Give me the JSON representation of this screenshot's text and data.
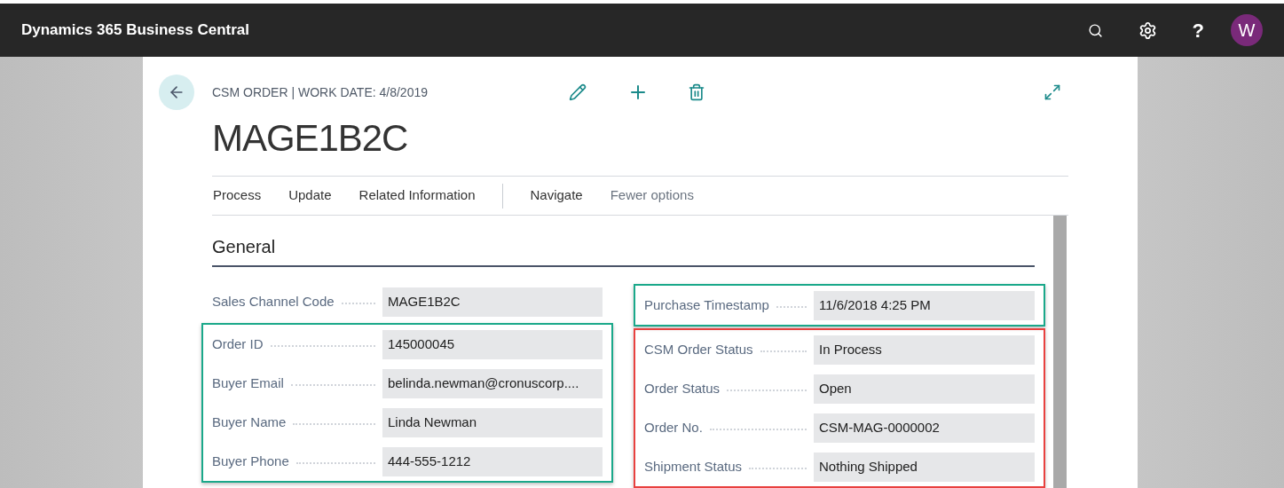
{
  "app_bar": {
    "title": "Dynamics 365 Business Central",
    "help": "?",
    "avatar": "W"
  },
  "page": {
    "caption": "CSM ORDER | WORK DATE: 4/8/2019",
    "title": "MAGE1B2C",
    "actions": [
      {
        "label": "Process",
        "kind": "menu"
      },
      {
        "label": "Update",
        "kind": "menu"
      },
      {
        "label": "Related Information",
        "kind": "menu"
      },
      {
        "kind": "separator"
      },
      {
        "label": "Navigate",
        "kind": "menu"
      },
      {
        "label": "Fewer options",
        "kind": "toggle"
      }
    ],
    "section": "General",
    "columns": [
      {
        "groups": [
          {
            "fields": [
              {
                "label": "Sales Channel Code",
                "value": "MAGE1B2C"
              }
            ]
          },
          {
            "color": "#1aa88a",
            "fields": [
              {
                "label": "Order ID",
                "value": "145000045"
              },
              {
                "label": "Buyer Email",
                "value": "belinda.newman@cronuscorp...."
              },
              {
                "label": "Buyer Name",
                "value": "Linda Newman"
              },
              {
                "label": "Buyer Phone",
                "value": "444-555-1212"
              }
            ]
          }
        ]
      },
      {
        "groups": [
          {
            "color": "#1aa88a",
            "fields": [
              {
                "label": "Purchase Timestamp",
                "value": "11/6/2018 4:25 PM"
              }
            ]
          },
          {
            "color": "#e8413f",
            "fields": [
              {
                "label": "CSM Order Status",
                "value": "In Process"
              },
              {
                "label": "Order Status",
                "value": "Open"
              },
              {
                "label": "Order No.",
                "value": "CSM-MAG-0000002"
              },
              {
                "label": "Shipment Status",
                "value": "Nothing Shipped"
              }
            ]
          }
        ]
      }
    ]
  }
}
